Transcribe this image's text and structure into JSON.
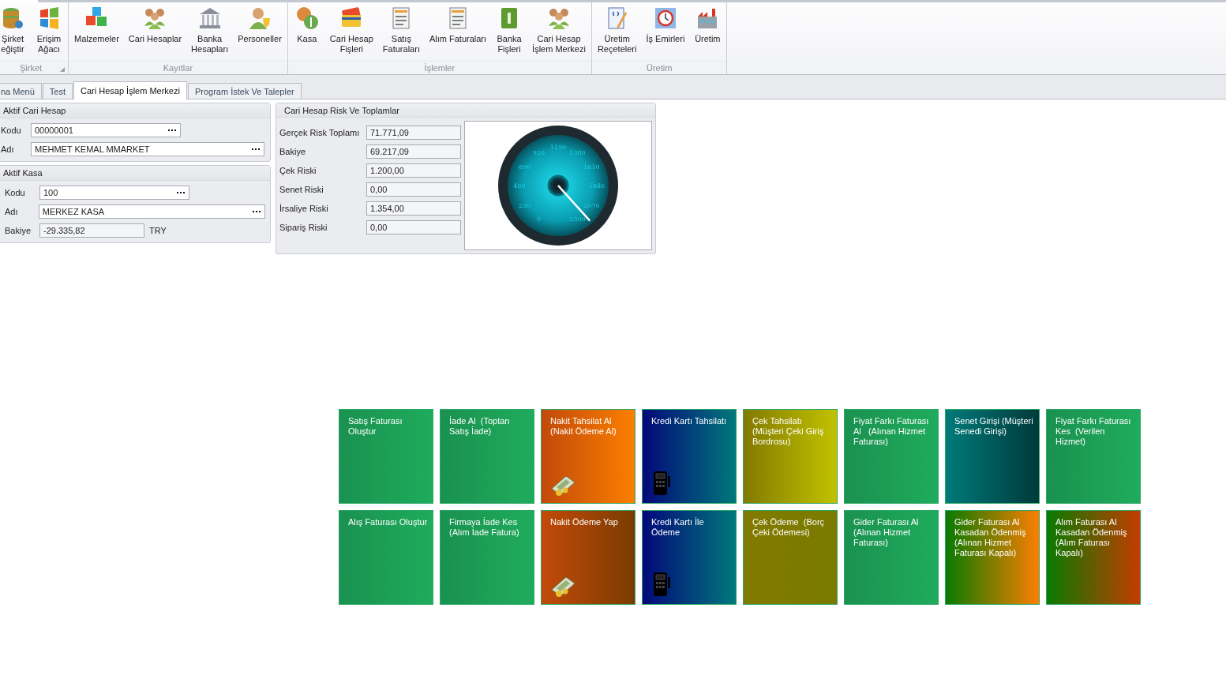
{
  "ribbon": {
    "groups": [
      {
        "label": "Şirket",
        "launcher": true,
        "buttons": [
          {
            "label": "Şirket\neğiştir"
          },
          {
            "label": "Erişim\nAğacı"
          }
        ]
      },
      {
        "label": "Kayıtlar",
        "launcher": false,
        "buttons": [
          {
            "label": "Malzemeler"
          },
          {
            "label": "Cari Hesaplar"
          },
          {
            "label": "Banka\nHesapları"
          },
          {
            "label": "Personeller"
          }
        ]
      },
      {
        "label": "İşlemler",
        "launcher": false,
        "buttons": [
          {
            "label": "Kasa"
          },
          {
            "label": "Cari Hesap\nFişleri"
          },
          {
            "label": "Satış\nFaturaları"
          },
          {
            "label": "Alım Faturaları"
          },
          {
            "label": "Banka\nFişleri"
          },
          {
            "label": "Cari Hesap\nİşlem Merkezi"
          }
        ]
      },
      {
        "label": "Üretim",
        "launcher": false,
        "buttons": [
          {
            "label": "Üretim\nReçeteleri"
          },
          {
            "label": "İş Emirleri"
          },
          {
            "label": "Üretim"
          }
        ]
      }
    ]
  },
  "tabs": [
    {
      "label": "na Menü",
      "selected": false
    },
    {
      "label": "Test",
      "selected": false
    },
    {
      "label": "Cari Hesap İşlem Merkezi",
      "selected": true
    },
    {
      "label": "Program İstek Ve Talepler",
      "selected": false
    }
  ],
  "active_account": {
    "title": "Aktif Cari Hesap",
    "fields": [
      {
        "label": "Kodu",
        "value": "00000001"
      },
      {
        "label": "Adı",
        "value": "MEHMET KEMAL MMARKET"
      }
    ]
  },
  "active_cash": {
    "title": "Aktif Kasa",
    "fields": [
      {
        "label": "Kodu",
        "value": "100"
      },
      {
        "label": "Adı",
        "value": "MERKEZ KASA"
      }
    ],
    "balance": {
      "label": "Bakiye",
      "value": "-29.335,82",
      "currency": "TRY"
    }
  },
  "risk": {
    "title": "Cari Hesap Risk Ve Toplamlar",
    "rows": [
      {
        "label": "Gerçek Risk Toplamı",
        "value": "71.771,09"
      },
      {
        "label": "Bakiye",
        "value": "69.217,09"
      },
      {
        "label": "Çek Riski",
        "value": "1.200,00"
      },
      {
        "label": "Senet Riski",
        "value": "0,00"
      },
      {
        "label": "İrsaliye Riski",
        "value": "1.354,00"
      },
      {
        "label": "Sipariş Riski",
        "value": "0,00"
      }
    ],
    "gauge": {
      "ticks": [
        "0",
        "230",
        "460",
        "690",
        "920",
        "1150",
        "1380",
        "1610",
        "1840",
        "2070",
        "2300"
      ]
    }
  },
  "tiles": [
    {
      "label": "Satış Faturası\nOluştur",
      "kind": "green"
    },
    {
      "label": "İade Al  (Toptan\nSatış İade)",
      "kind": "green"
    },
    {
      "label": "Nakit Tahsilat Al\n(Nakit Ödeme Al)",
      "kind": "cashin"
    },
    {
      "label": "Kredi Kartı Tahsilatı",
      "kind": "card"
    },
    {
      "label": "Çek Tahsilatı\n(Müşteri Çeki Giriş\nBordrosu)",
      "kind": "chequein"
    },
    {
      "label": "Fiyat Farkı Faturası\nAl   (Alınan Hizmet\nFaturası)",
      "kind": "green"
    },
    {
      "label": "Senet Girişi (Müşteri\nSenedi Girişi)",
      "kind": "note"
    },
    {
      "label": "Fiyat Farkı Faturası\nKes  (Verilen\nHizmet)",
      "kind": "green"
    },
    {
      "label": "Alış Faturası Oluştur",
      "kind": "green"
    },
    {
      "label": "Firmaya İade Kes\n(Alım İade Fatura)",
      "kind": "green"
    },
    {
      "label": "Nakit Ödeme Yap",
      "kind": "cashout"
    },
    {
      "label": "Kredi Kartı İle\nÖdeme",
      "kind": "card"
    },
    {
      "label": "Çek Ödeme  (Borç\nÇeki Ödemesi)",
      "kind": "chequeout"
    },
    {
      "label": "Gider Faturası Al\n(Alınan Hizmet\nFaturası)",
      "kind": "green"
    },
    {
      "label": "Gider Faturası Al\nKasadan Ödenmiş\n(Alınan Hizmet\nFaturası Kapalı)",
      "kind": "expense"
    },
    {
      "label": "Alım Faturası Al\nKasadan Ödenmiş\n(Alım Faturası\nKapalı)",
      "kind": "purchase"
    }
  ]
}
